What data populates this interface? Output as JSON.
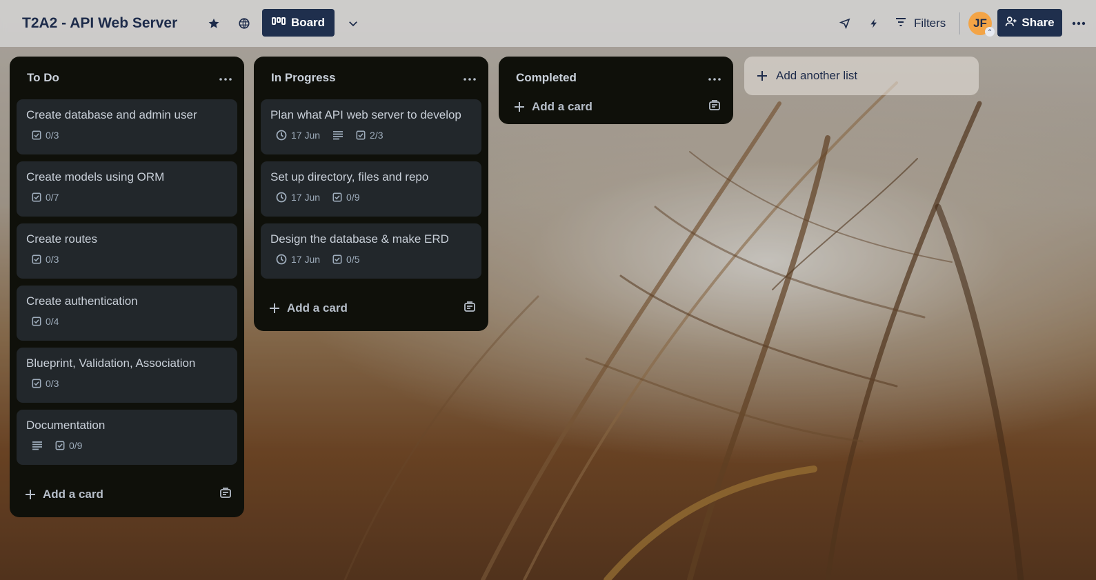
{
  "header": {
    "board_title": "T2A2 - API Web Server",
    "view_label": "Board",
    "filters_label": "Filters",
    "avatar_initials": "JF",
    "share_label": "Share"
  },
  "lists": [
    {
      "title": "To Do",
      "menu": "···",
      "add_card_label": "Add a card",
      "cards": [
        {
          "title": "Create database and admin user",
          "checklist": "0/3"
        },
        {
          "title": "Create models using ORM",
          "checklist": "0/7"
        },
        {
          "title": "Create routes",
          "checklist": "0/3"
        },
        {
          "title": "Create authentication",
          "checklist": "0/4"
        },
        {
          "title": "Blueprint, Validation, Association",
          "checklist": "0/3"
        },
        {
          "title": "Documentation",
          "checklist": "0/9",
          "has_description": true
        }
      ]
    },
    {
      "title": "In Progress",
      "menu": "···",
      "add_card_label": "Add a card",
      "cards": [
        {
          "title": "Plan what API web server to develop",
          "due": "17 Jun",
          "has_description": true,
          "checklist": "2/3"
        },
        {
          "title": "Set up directory, files and repo",
          "due": "17 Jun",
          "checklist": "0/9"
        },
        {
          "title": "Design the database & make ERD",
          "due": "17 Jun",
          "checklist": "0/5"
        }
      ]
    },
    {
      "title": "Completed",
      "menu": "···",
      "add_card_label": "Add a card",
      "cards": []
    }
  ],
  "add_list_label": "Add another list",
  "colors": {
    "header_bg": "#d7d7d7",
    "primary_button": "#1f2f4d",
    "list_bg": "#0f100a",
    "card_bg": "#22272b",
    "avatar": "#f3a446"
  },
  "icons": [
    "star-icon",
    "globe-icon",
    "board-icon",
    "chevron-down-icon",
    "rocket-icon",
    "lightning-icon",
    "filter-icon",
    "share-person-icon",
    "more-icon",
    "checklist-icon",
    "clock-icon",
    "description-icon",
    "plus-icon",
    "template-icon"
  ]
}
